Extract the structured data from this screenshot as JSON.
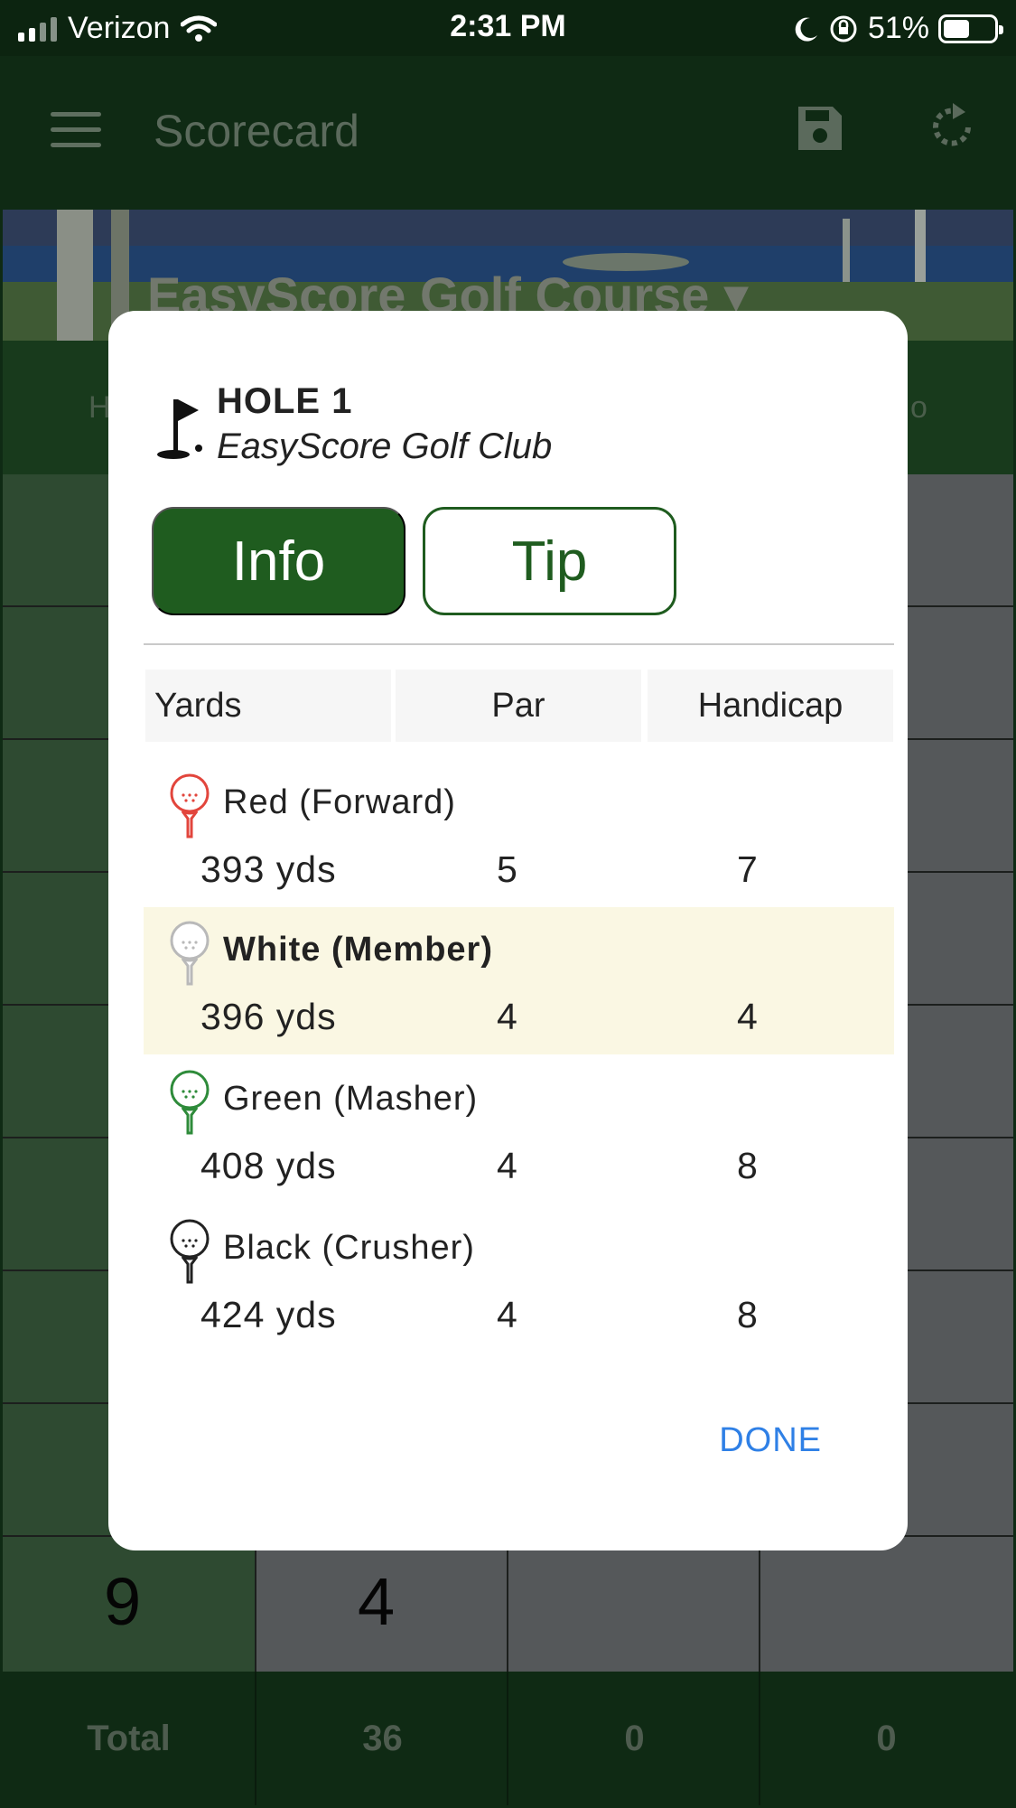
{
  "status_bar": {
    "carrier": "Verizon",
    "time": "2:31 PM",
    "battery": "51%"
  },
  "app_bar": {
    "title": "Scorecard"
  },
  "background": {
    "course_banner": "EasyScore Golf Course ▾",
    "visible_row": {
      "hole": "9",
      "par": "4"
    },
    "totals": {
      "label": "Total",
      "par": "36",
      "col3": "0",
      "col4": "0"
    }
  },
  "dialog": {
    "hole_title": "HOLE 1",
    "club_name": "EasyScore Golf Club",
    "tabs": {
      "info": "Info",
      "tip": "Tip"
    },
    "table_headers": {
      "yards": "Yards",
      "par": "Par",
      "handicap": "Handicap"
    },
    "tees": [
      {
        "name": "Red (Forward)",
        "yards": "393 yds",
        "par": "5",
        "handicap": "7",
        "color": "#e2453c",
        "highlight": false
      },
      {
        "name": "White (Member)",
        "yards": "396 yds",
        "par": "4",
        "handicap": "4",
        "color": "#b9b9b9",
        "highlight": true
      },
      {
        "name": "Green (Masher)",
        "yards": "408 yds",
        "par": "4",
        "handicap": "8",
        "color": "#2e8b3a",
        "highlight": false
      },
      {
        "name": "Black (Crusher)",
        "yards": "424 yds",
        "par": "4",
        "handicap": "8",
        "color": "#222222",
        "highlight": false
      }
    ],
    "done_label": "DONE"
  }
}
